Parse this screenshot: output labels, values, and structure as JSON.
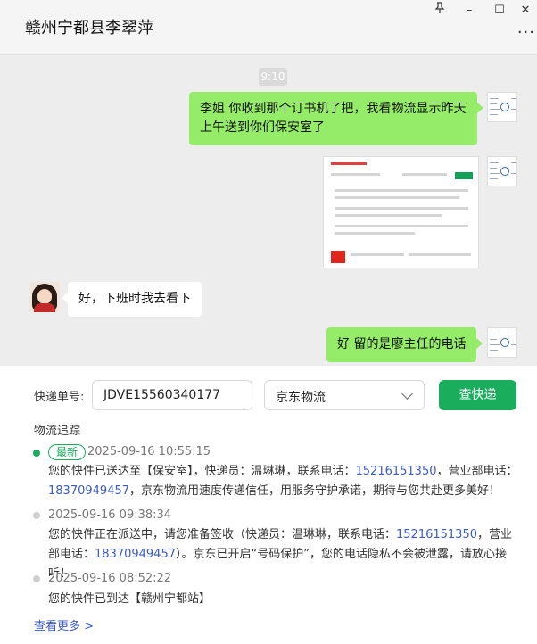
{
  "window": {
    "title": "赣州宁都县李翠萍",
    "pin_icon": "pin-icon",
    "minimize": "–",
    "maximize": "☐",
    "close": "✕",
    "more": "···"
  },
  "chat": {
    "time": "9:10",
    "messages": [
      {
        "from": "me",
        "text": "李姐  你收到那个订书机了把，我看物流显示昨天上午送到你们保安室了"
      },
      {
        "from": "me",
        "type": "image"
      },
      {
        "from": "other",
        "text": "好，下班时我去看下"
      },
      {
        "from": "me",
        "text": "好  留的是廖主任的电话"
      }
    ]
  },
  "tracking": {
    "number_label": "快递单号:",
    "number_value": "JDVE15560340177",
    "courier": "京东物流",
    "query_button": "查快递",
    "section_title": "物流追踪",
    "latest_badge": "最新",
    "events": [
      {
        "time": "2025-09-16 10:55:15",
        "text_a": "您的快件已送达至【保安室】，快递员：温琳琳，联系电话：",
        "phone_a": "15216151350",
        "text_b": "，营业部电话：",
        "phone_b": "18370949457",
        "text_c": "，京东物流用速度传递信任，用服务守护承诺，期待与您共赴更多美好！"
      },
      {
        "time": "2025-09-16 09:38:34",
        "text_a": "您的快件正在派送中，请您准备签收（快递员：温琳琳，联系电话：",
        "phone_a": "15216151350",
        "text_b": "，营业部电话：",
        "phone_b": "18370949457",
        "text_c": "）。京东已开启“号码保护”，您的电话隐私不会被泄露，请放心接听！"
      },
      {
        "time": "2025-09-16 08:52:22",
        "text_a": "您的快件已到达【赣州宁都站】"
      }
    ],
    "more_link": "查看更多 >"
  }
}
